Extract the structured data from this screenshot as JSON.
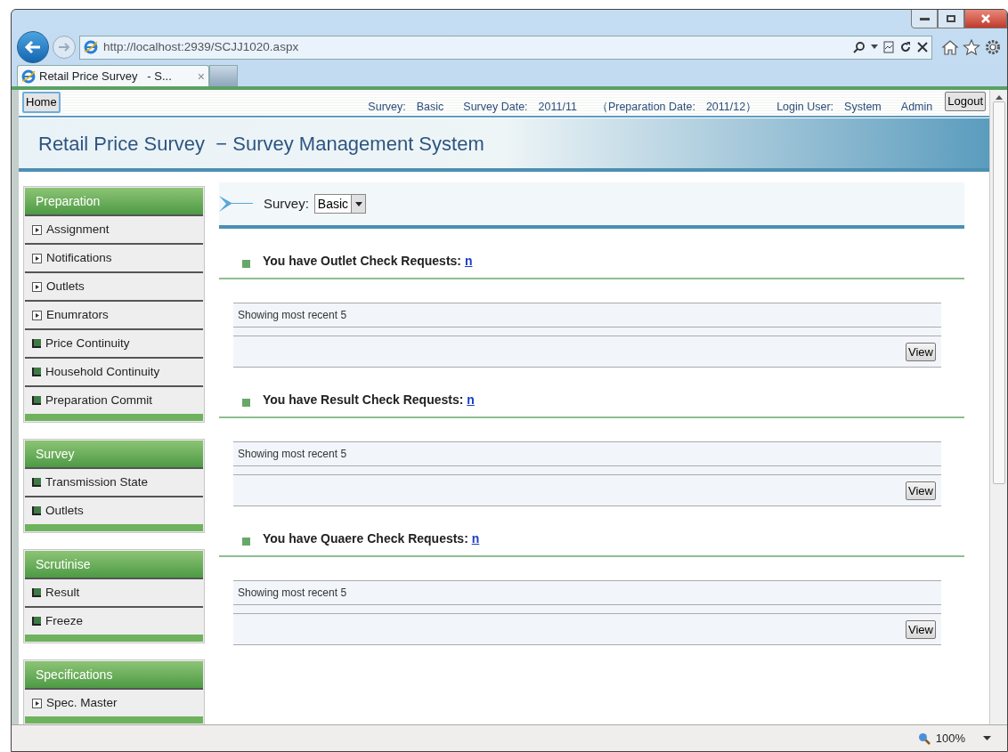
{
  "browser": {
    "url": "http://localhost:2939/SCJJ1020.aspx",
    "tab": {
      "title": "Retail Price Survey   - S...",
      "close": "×"
    },
    "zoom": "100%"
  },
  "header": {
    "home_button": "Home",
    "info": [
      "Survey:",
      "Basic",
      "Survey Date:",
      "2011/11",
      "（Preparation Date:",
      "2011/12）",
      "Login User:",
      "System",
      "Admin"
    ],
    "logout_button": "Logout"
  },
  "banner": {
    "title": "Retail Price Survey  − Survey Management System"
  },
  "sidebar": [
    {
      "title": "Preparation",
      "items": [
        {
          "label": "Assignment",
          "kind": "page"
        },
        {
          "label": "Notifications",
          "kind": "page"
        },
        {
          "label": "Outlets",
          "kind": "page"
        },
        {
          "label": "Enumrators",
          "kind": "page"
        },
        {
          "label": "Price Continuity",
          "kind": "bullet"
        },
        {
          "label": "Household Continuity",
          "kind": "bullet"
        },
        {
          "label": "Preparation Commit",
          "kind": "bullet"
        }
      ]
    },
    {
      "title": "Survey",
      "items": [
        {
          "label": "Transmission State",
          "kind": "bullet"
        },
        {
          "label": "Outlets",
          "kind": "bullet"
        }
      ]
    },
    {
      "title": "Scrutinise",
      "items": [
        {
          "label": "Result",
          "kind": "bullet"
        },
        {
          "label": "Freeze",
          "kind": "bullet"
        }
      ]
    },
    {
      "title": "Specifications",
      "items": [
        {
          "label": "Spec. Master",
          "kind": "page"
        }
      ]
    }
  ],
  "survey_select": {
    "label": "Survey:",
    "value": "Basic"
  },
  "requests": [
    {
      "heading": "You have Outlet Check Requests:",
      "link": "n",
      "note": "Showing most recent 5",
      "button": "View"
    },
    {
      "heading": "You have Result Check Requests:",
      "link": "n",
      "note": "Showing most recent 5",
      "button": "View"
    },
    {
      "heading": "You have Quaere Check Requests:",
      "link": "n",
      "note": "Showing most recent 5",
      "button": "View"
    }
  ]
}
